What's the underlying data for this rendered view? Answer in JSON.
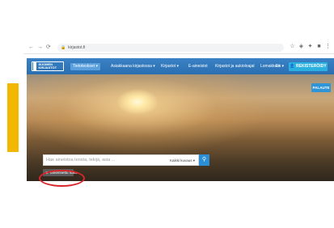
{
  "browser": {
    "back_icon": "back-arrow-icon",
    "forward_icon": "forward-arrow-icon",
    "reload_icon": "reload-icon",
    "url": "kirjastot.fi",
    "extensions": [
      "star-icon",
      "extension-icon",
      "puzzle-icon",
      "bookmark-icon",
      "menu-icon"
    ]
  },
  "navbar": {
    "logo_text": "SUOMEN KIRJASTOT",
    "items": [
      {
        "label": "Tietoteokset ▾"
      },
      {
        "label": "Asiakkaana kirjastossa ▾"
      },
      {
        "label": "Kirjastot ▾"
      },
      {
        "label": "E-aineistot"
      },
      {
        "label": "Kirjastot ja aukioloajat"
      },
      {
        "label": "Lomakkeet"
      }
    ],
    "language": "En ▾",
    "register_label": "REKISTERÖIDY"
  },
  "hero": {
    "feedback_label": "PALAUTE",
    "search_placeholder": "Hae aineistoa teosta, tekijä, asia ...",
    "search_scope": "Kaikki kuvaus ▾",
    "advanced_search_label": "Tarkennettu haku"
  },
  "colors": {
    "accent": "#2a8fd6",
    "navbar": "#3a82c6",
    "highlight": "#d8262a",
    "yellow": "#f2b701"
  }
}
